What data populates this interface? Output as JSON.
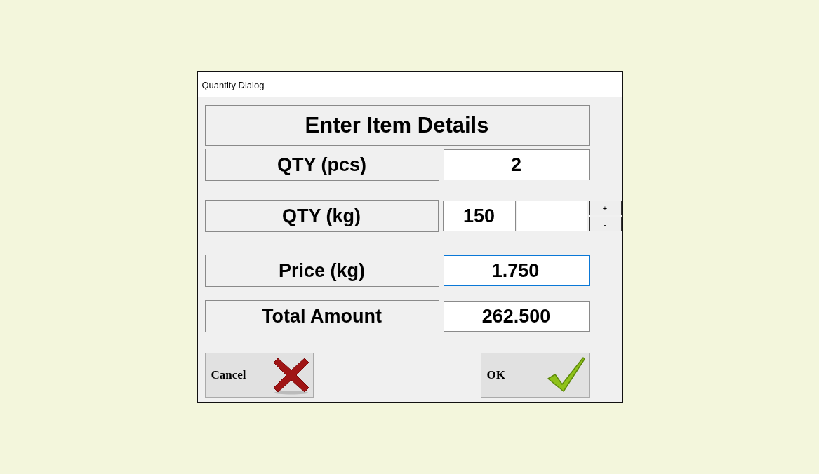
{
  "window": {
    "title": "Quantity Dialog"
  },
  "heading": "Enter Item Details",
  "rows": [
    {
      "kind": "single",
      "label": "QTY (pcs)",
      "value": "2",
      "focused": false
    },
    {
      "kind": "spinner",
      "label": "QTY (kg)",
      "value": "150",
      "increment": "+",
      "decrement": "-",
      "focused": false
    },
    {
      "kind": "single",
      "label": "Price (kg)",
      "value": "1.750",
      "focused": true
    },
    {
      "kind": "single",
      "label": "Total Amount",
      "value": "262.500",
      "focused": false
    }
  ],
  "buttons": [
    {
      "kind": "cancel",
      "label": "Cancel"
    },
    {
      "kind": "ok",
      "label": "OK"
    }
  ]
}
